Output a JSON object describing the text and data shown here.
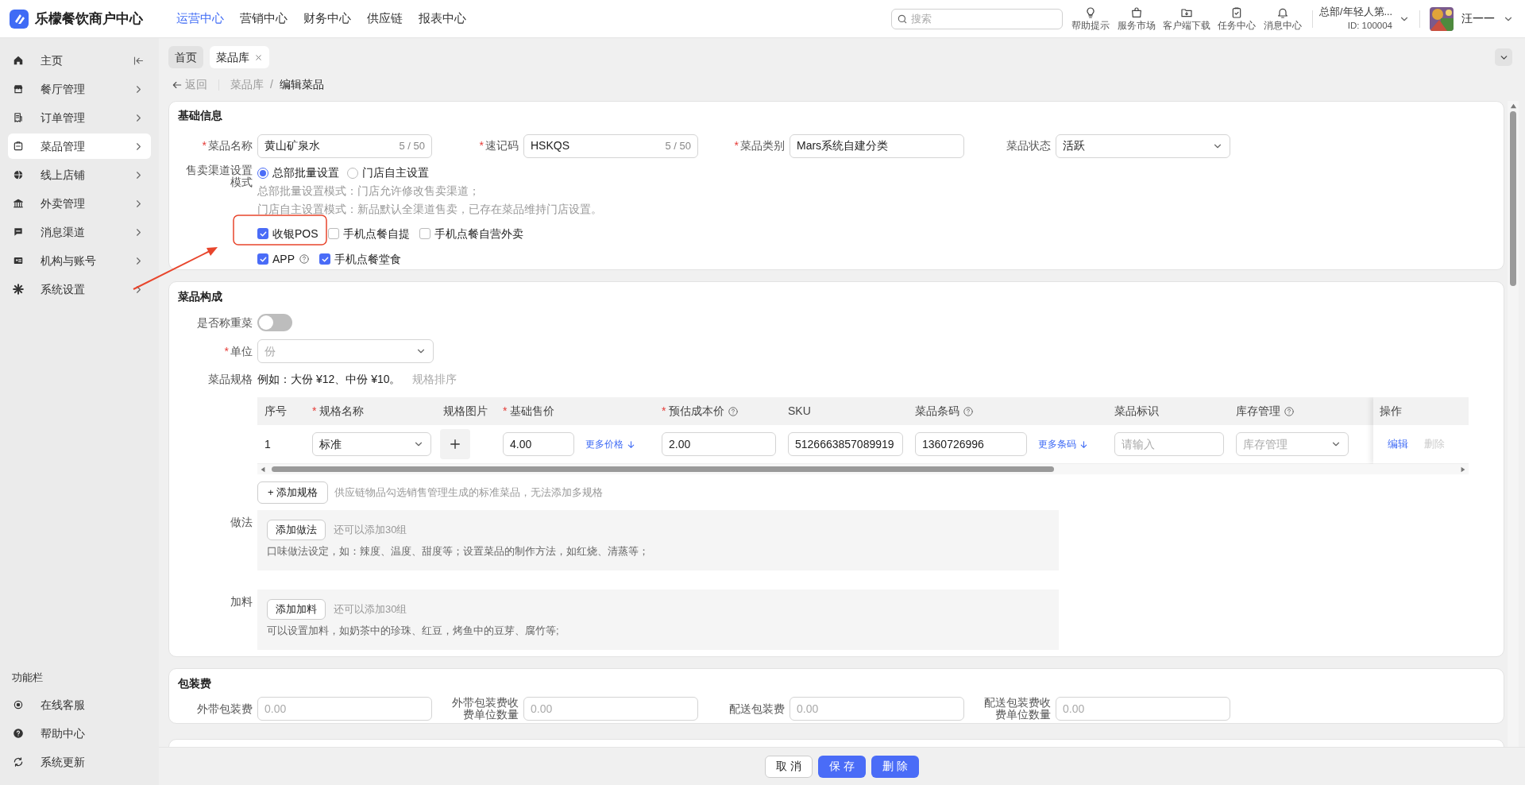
{
  "header": {
    "logo": "乐檬餐饮商户中心",
    "nav": [
      {
        "label": "运营中心",
        "selected": true
      },
      {
        "label": "营销中心",
        "selected": false
      },
      {
        "label": "财务中心",
        "selected": false
      },
      {
        "label": "供应链",
        "selected": false
      },
      {
        "label": "报表中心",
        "selected": false
      }
    ],
    "search": {
      "placeholder": "搜索"
    },
    "tools": [
      {
        "kind": "bulb",
        "label": "帮助提示"
      },
      {
        "kind": "bag",
        "label": "服务市场"
      },
      {
        "kind": "download",
        "label": "客户端下载"
      },
      {
        "kind": "task",
        "label": "任务中心"
      },
      {
        "kind": "bell",
        "label": "消息中心"
      }
    ],
    "org": "总部/年轻人第...",
    "org_id": "ID: 100004",
    "user": "汪一一"
  },
  "sidebar": {
    "collapse_button": true,
    "items": [
      {
        "kind": "home",
        "label": "主页",
        "selected": false,
        "has_submenu": false
      },
      {
        "kind": "store",
        "label": "餐厅管理",
        "selected": false,
        "has_submenu": true
      },
      {
        "kind": "receipt",
        "label": "订单管理",
        "selected": false,
        "has_submenu": true
      },
      {
        "kind": "dish",
        "label": "菜品管理",
        "selected": true,
        "has_submenu": true
      },
      {
        "kind": "globe",
        "label": "线上店铺",
        "selected": false,
        "has_submenu": true
      },
      {
        "kind": "bank",
        "label": "外卖管理",
        "selected": false,
        "has_submenu": true
      },
      {
        "kind": "chat",
        "label": "消息渠道",
        "selected": false,
        "has_submenu": true
      },
      {
        "kind": "idcard",
        "label": "机构与账号",
        "selected": false,
        "has_submenu": true
      },
      {
        "kind": "gear",
        "label": "系统设置",
        "selected": false,
        "has_submenu": true
      }
    ],
    "footer_title": "功能栏",
    "footer_items": [
      {
        "kind": "service",
        "label": "在线客服"
      },
      {
        "kind": "help",
        "label": "帮助中心"
      },
      {
        "kind": "update",
        "label": "系统更新"
      }
    ]
  },
  "tabs": [
    {
      "label": "首页",
      "selected": false,
      "closable": false
    },
    {
      "label": "菜品库",
      "selected": true,
      "closable": true
    }
  ],
  "breadcrumb": {
    "back": "返回",
    "items": [
      {
        "label": "菜品库",
        "current": false
      },
      {
        "separator": "/",
        "label": "编辑菜品",
        "current": true
      }
    ]
  },
  "basic": {
    "title": "基础信息",
    "fields": [
      {
        "required": "*",
        "label": "菜品名称",
        "kind": "input",
        "value": "黄山矿泉水",
        "counter": "5 / 50"
      },
      {
        "required": "*",
        "label": "速记码",
        "kind": "input",
        "value": "HSKQS",
        "counter": "5 / 50"
      },
      {
        "required": "*",
        "label": "菜品类别",
        "kind": "input",
        "value": "Mars系统自建分类"
      },
      {
        "label": "菜品状态",
        "kind": "select",
        "value": "活跃"
      }
    ],
    "mode": {
      "label": "售卖渠道设置模式",
      "options": [
        {
          "label": "总部批量设置",
          "selected": true
        },
        {
          "label": "门店自主设置",
          "selected": false
        }
      ],
      "notes": [
        "总部批量设置模式：门店允许修改售卖渠道；",
        "门店自主设置模式：新品默认全渠道售卖，已存在菜品维持门店设置。"
      ]
    },
    "channel_rows": [
      {
        "items": [
          {
            "label": "收银POS",
            "checked": true,
            "help": false
          },
          {
            "label": "手机点餐自提",
            "checked": false,
            "help": false
          },
          {
            "label": "手机点餐自营外卖",
            "checked": false,
            "help": false
          }
        ]
      },
      {
        "items": [
          {
            "label": "APP",
            "checked": true,
            "help": true
          },
          {
            "label": "手机点餐堂食",
            "checked": true,
            "help": false
          }
        ]
      }
    ]
  },
  "composition": {
    "title": "菜品构成",
    "weighed": {
      "label": "是否称重菜",
      "on": false
    },
    "unit": {
      "required": "*",
      "label": "单位",
      "placeholder": "份"
    },
    "spec": {
      "label": "菜品规格",
      "example": "例如：大份 ¥12、中份 ¥10。",
      "sort": "规格排序"
    },
    "table": {
      "columns": [
        {
          "label": "序号",
          "help": false
        },
        {
          "required": "*",
          "label": "规格名称",
          "help": false
        },
        {
          "label": "规格图片",
          "help": false
        },
        {
          "required": "*",
          "label": "基础售价",
          "help": false
        },
        {
          "required": "*",
          "label": "预估成本价",
          "help": true
        },
        {
          "label": "SKU",
          "help": false
        },
        {
          "label": "菜品条码",
          "help": true
        },
        {
          "label": "菜品标识",
          "help": false
        },
        {
          "label": "库存管理",
          "help": true
        },
        {
          "label": "操作",
          "help": false
        }
      ],
      "rows": [
        {
          "cells": [
            {
              "kind": "text",
              "value": "1"
            },
            {
              "kind": "select",
              "value": "标准"
            },
            {
              "kind": "image_add"
            },
            {
              "kind": "input_link",
              "value": "4.00",
              "link": "更多价格"
            },
            {
              "kind": "input",
              "value": "2.00"
            },
            {
              "kind": "input",
              "value": "5126663857089919"
            },
            {
              "kind": "input_link",
              "value": "1360726996",
              "link": "更多条码"
            },
            {
              "kind": "input",
              "placeholder": "请输入"
            },
            {
              "kind": "select",
              "placeholder": "库存管理"
            },
            {
              "kind": "actions",
              "actions": [
                {
                  "label": "编辑",
                  "disabled": false
                },
                {
                  "label": "删除",
                  "disabled": true
                }
              ]
            }
          ]
        }
      ]
    },
    "add_spec": {
      "button": "+ 添加规格",
      "note": "供应链物品勾选销售管理生成的标准菜品，无法添加多规格"
    },
    "groups": [
      {
        "label": "做法",
        "button": "添加做法",
        "remaining": "还可以添加30组",
        "hint": "口味做法设定，如：辣度、温度、甜度等；设置菜品的制作方法，如红烧、清蒸等；"
      },
      {
        "label": "加料",
        "button": "添加加料",
        "remaining": "还可以添加30组",
        "hint": "可以设置加料，如奶茶中的珍珠、红豆，烤鱼中的豆芽、腐竹等;"
      }
    ]
  },
  "packaging": {
    "title": "包装费",
    "fields": [
      {
        "label": "外带包装费",
        "placeholder": "0.00"
      },
      {
        "label": "外带包装费收费单位数量",
        "placeholder": "0.00"
      },
      {
        "label": "配送包装费",
        "placeholder": "0.00"
      },
      {
        "label": "配送包装费收费单位数量",
        "placeholder": "0.00"
      }
    ]
  },
  "footer_buttons": [
    {
      "label": "取 消",
      "kind": "default"
    },
    {
      "label": "保 存",
      "kind": "primary"
    },
    {
      "label": "删 除",
      "kind": "primary"
    }
  ]
}
